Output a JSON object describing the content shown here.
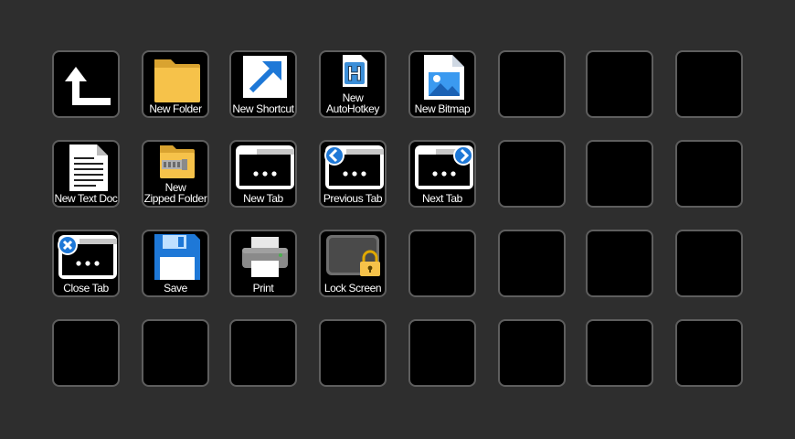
{
  "keys": {
    "back": {
      "label": ""
    },
    "new_folder": {
      "label": "New Folder"
    },
    "new_shortcut": {
      "label": "New Shortcut"
    },
    "new_autohotkey": {
      "label_line1": "New",
      "label_line2": "AutoHotkey",
      "icon_letter": "H"
    },
    "new_bitmap": {
      "label": "New Bitmap"
    },
    "new_text_doc": {
      "label": "New Text Doc"
    },
    "new_zipped": {
      "label_line1": "New",
      "label_line2": "Zipped Folder"
    },
    "new_tab": {
      "label": "New Tab"
    },
    "previous_tab": {
      "label": "Previous Tab"
    },
    "next_tab": {
      "label": "Next Tab"
    },
    "close_tab": {
      "label": "Close Tab"
    },
    "save": {
      "label": "Save"
    },
    "print": {
      "label": "Print"
    },
    "lock_screen": {
      "label": "Lock Screen"
    }
  },
  "colors": {
    "background": "#2e2e2e",
    "key_border": "#5e5e5e",
    "folder_yellow": "#f6c24a",
    "accent_blue": "#1e78d7"
  }
}
